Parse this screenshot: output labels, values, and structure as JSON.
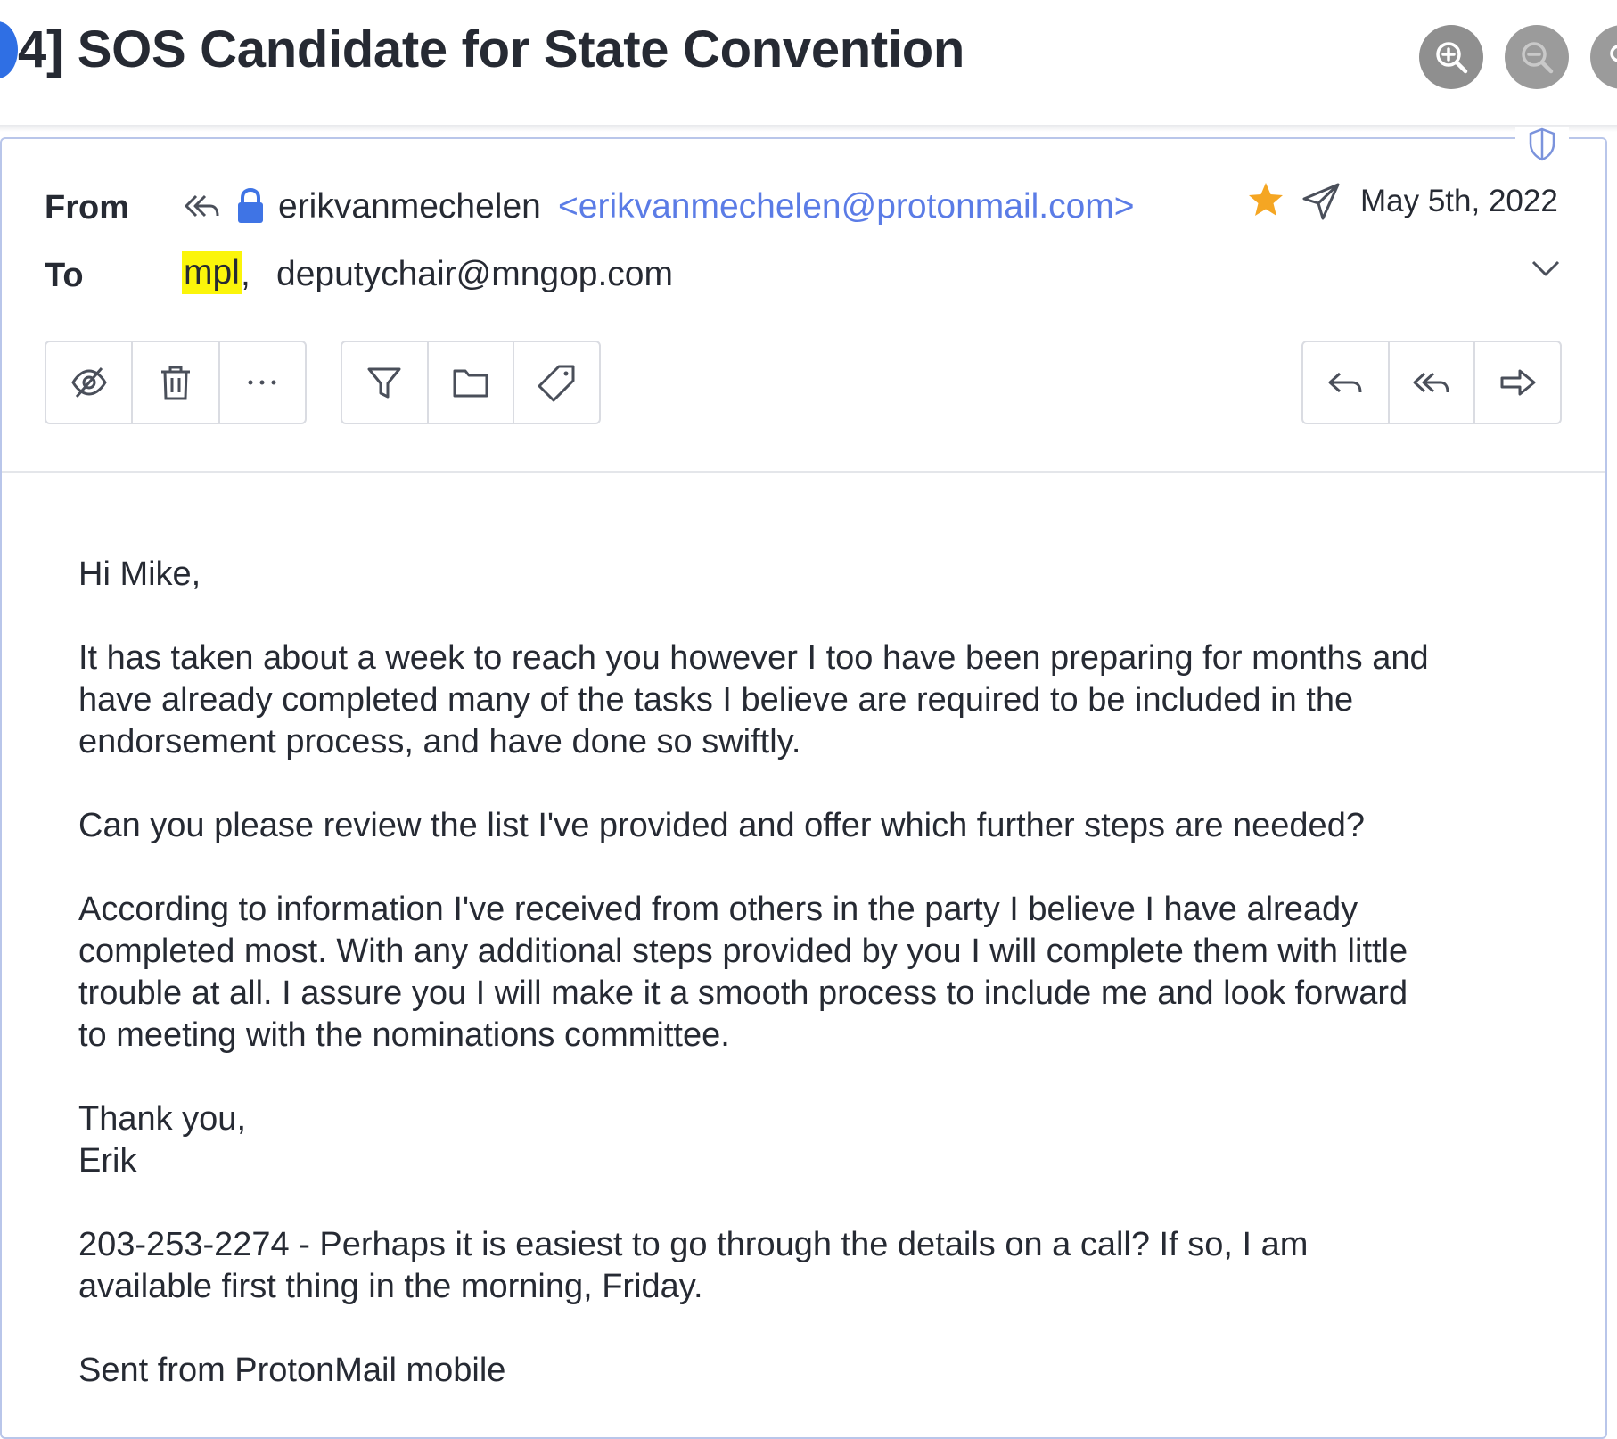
{
  "header": {
    "subject": "4] SOS Candidate for State Convention",
    "zoom_in_icon": "zoom-in-icon",
    "zoom_out_icon": "zoom-out-icon"
  },
  "message": {
    "from_label": "From",
    "to_label": "To",
    "sender_name": "erikvanmechelen",
    "sender_email": "<erikvanmechelen@protonmail.com>",
    "date": "May 5th, 2022",
    "recipients": [
      "mpl",
      "deputychair@mngop.com"
    ],
    "recipient_separator": ",",
    "highlight_color": "#fbf50a",
    "link_color": "#5b7ce6",
    "star_color": "#f5a623"
  },
  "toolbar": {
    "left_group": [
      "eye-slash-icon",
      "trash-icon",
      "more-icon"
    ],
    "middle_group": [
      "filter-icon",
      "folder-icon",
      "tag-icon"
    ],
    "right_group": [
      "reply-icon",
      "reply-all-icon",
      "forward-icon"
    ]
  },
  "body": {
    "greeting": "Hi Mike,",
    "p1": [
      "It has taken about a week to reach you however I too have been preparing for months and",
      "have already completed many of the tasks I believe are required to be included in the",
      "endorsement process, and have done so swiftly."
    ],
    "p2": [
      "Can you please review the list I've provided and offer which further steps are needed?"
    ],
    "p3": [
      "According to information I've received from others in the party I believe I have already",
      "completed most. With any additional steps provided by you I will complete them with little",
      "trouble at all. I assure you I will make it a smooth process to include me and look forward",
      "to meeting with the nominations committee."
    ],
    "closing": [
      "Thank you,",
      "Erik"
    ],
    "p4": [
      "203-253-2274 - Perhaps it is easiest to go through the details on a call? If so, I am",
      "available first thing in the morning, Friday."
    ],
    "signature": "Sent from ProtonMail mobile"
  }
}
